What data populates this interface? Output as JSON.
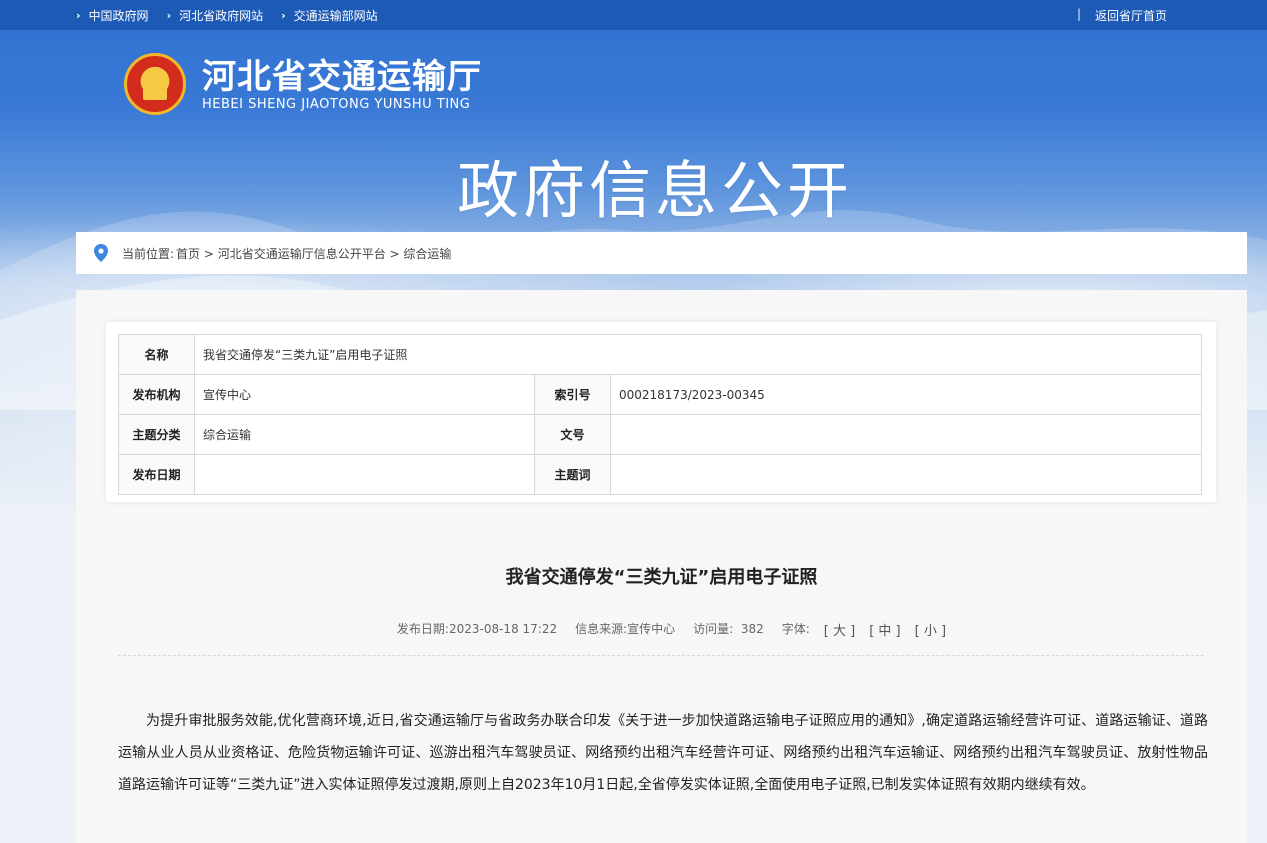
{
  "topbar": {
    "links": [
      "中国政府网",
      "河北省政府网站",
      "交通运输部网站"
    ],
    "separator": "|",
    "home_link": "返回省厅首页"
  },
  "brand": {
    "name_cn": "河北省交通运输厅",
    "name_en": "HEBEI SHENG JIAOTONG YUNSHU TING",
    "section_title": "政府信息公开"
  },
  "breadcrumb": {
    "label": "当前位置:",
    "path": "首页 > 河北省交通运输厅信息公开平台 > 综合运输"
  },
  "meta_table": {
    "name_label": "名称",
    "name_value": "我省交通停发“三类九证”启用电子证照",
    "publisher_label": "发布机构",
    "publisher_value": "宣传中心",
    "index_label": "索引号",
    "index_value": "000218173/2023-00345",
    "category_label": "主题分类",
    "category_value": "综合运输",
    "doc_no_label": "文号",
    "doc_no_value": "",
    "date_label": "发布日期",
    "date_value": "",
    "keywords_label": "主题词",
    "keywords_value": ""
  },
  "article": {
    "title": "我省交通停发“三类九证”启用电子证照",
    "publish_date": "发布日期:2023-08-18 17:22",
    "source": "信息来源:宣传中心",
    "views_label": "访问量:",
    "views": "382",
    "font_label": "字体:",
    "font_large": "[ 大 ]",
    "font_medium": "[ 中 ]",
    "font_small": "[ 小 ]",
    "body": "为提升审批服务效能,优化营商环境,近日,省交通运输厅与省政务办联合印发《关于进一步加快道路运输电子证照应用的通知》,确定道路运输经营许可证、道路运输证、道路运输从业人员从业资格证、危险货物运输许可证、巡游出租汽车驾驶员证、网络预约出租汽车经营许可证、网络预约出租汽车运输证、网络预约出租汽车驾驶员证、放射性物品道路运输许可证等“三类九证”进入实体证照停发过渡期,原则上自2023年10月1日起,全省停发实体证照,全面使用电子证照,已制发实体证照有效期内继续有效。"
  },
  "colors": {
    "topbar": "#1d5ab6",
    "hero_top": "#2f6fd0",
    "pin": "#3c87e0"
  }
}
